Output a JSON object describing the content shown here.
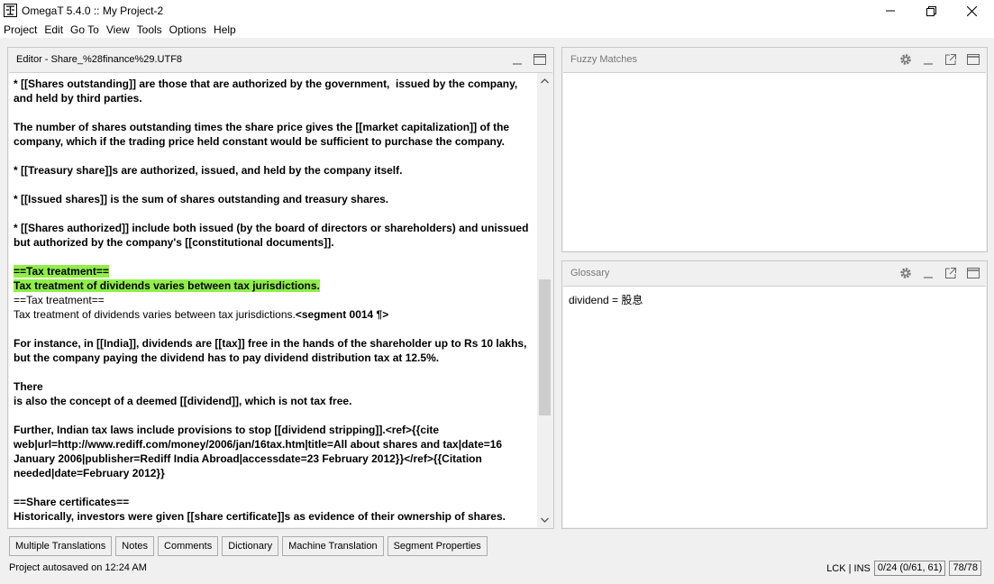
{
  "window": {
    "title": "OmegaT 5.4.0 :: My Project-2",
    "min_glyph": "—",
    "max_glyph": "❐",
    "close_glyph": "✕"
  },
  "menu": [
    "Project",
    "Edit",
    "Go To",
    "View",
    "Tools",
    "Options",
    "Help"
  ],
  "editor": {
    "title": "Editor - Share_%28finance%29.UTF8",
    "lines": [
      {
        "t": "* [[Shares outstanding]] are those that are authorized by the government,  issued by the company,",
        "s": "b"
      },
      {
        "t": "and held by third parties.",
        "s": "b"
      },
      {
        "t": "",
        "s": "b"
      },
      {
        "t": "The number of shares outstanding times the share price gives the [[market capitalization]] of the",
        "s": "b"
      },
      {
        "t": "company, which if the trading price held constant would be sufficient to purchase the company.",
        "s": "b"
      },
      {
        "t": "",
        "s": "b"
      },
      {
        "t": "* [[Treasury share]]s are authorized, issued, and held by the company itself.",
        "s": "b"
      },
      {
        "t": "",
        "s": "b"
      },
      {
        "t": "* [[Issued shares]] is the sum of shares outstanding and treasury shares.",
        "s": "b"
      },
      {
        "t": "",
        "s": "b"
      },
      {
        "t": "* [[Shares authorized]] include both issued (by the board of directors or shareholders) and unissued",
        "s": "b"
      },
      {
        "t": "but authorized by the company's [[constitutional documents]].",
        "s": "b"
      },
      {
        "t": "",
        "s": "b"
      },
      {
        "t": "==Tax treatment==",
        "s": "hl"
      },
      {
        "t": "Tax treatment of dividends varies between tax jurisdictions.",
        "s": "hl"
      },
      {
        "t": "==Tax treatment==",
        "s": "n"
      },
      {
        "t": "Tax treatment of dividends varies between tax jurisdictions.",
        "s": "n",
        "tag": "<segment 0014 ¶>"
      },
      {
        "t": "",
        "s": "b"
      },
      {
        "t": "For instance, in [[India]], dividends are [[tax]] free in the hands of the shareholder up to Rs 10 lakhs,",
        "s": "b"
      },
      {
        "t": "but the company paying the dividend has to pay dividend distribution tax at 12.5%.",
        "s": "b"
      },
      {
        "t": "",
        "s": "b"
      },
      {
        "t": "There",
        "s": "b"
      },
      {
        "t": "is also the concept of a deemed [[dividend]], which is not tax free.",
        "s": "b"
      },
      {
        "t": "",
        "s": "b"
      },
      {
        "t": "Further, Indian tax laws include provisions to stop [[dividend stripping]].<ref>{{cite",
        "s": "b"
      },
      {
        "t": "web|url=http://www.rediff.com/money/2006/jan/16tax.htm|title=All about shares and tax|date=16",
        "s": "b"
      },
      {
        "t": "January 2006|publisher=Rediff India Abroad|accessdate=23 February 2012}}</ref>{{Citation",
        "s": "b"
      },
      {
        "t": "needed|date=February 2012}}",
        "s": "b"
      },
      {
        "t": "",
        "s": "b"
      },
      {
        "t": "==Share certificates==",
        "s": "b"
      },
      {
        "t": "Historically, investors were given [[share certificate]]s as evidence of their ownership of shares.",
        "s": "b"
      }
    ]
  },
  "fuzzy": {
    "title": "Fuzzy Matches"
  },
  "glossary": {
    "title": "Glossary",
    "entry": "dividend = 股息"
  },
  "tabs": [
    "Multiple Translations",
    "Notes",
    "Comments",
    "Dictionary",
    "Machine Translation",
    "Segment Properties"
  ],
  "status": {
    "message": "Project autosaved on 12:24 AM",
    "mode": "LCK | INS",
    "progress": "0/24 (0/61, 61)",
    "segments": "78/78"
  }
}
